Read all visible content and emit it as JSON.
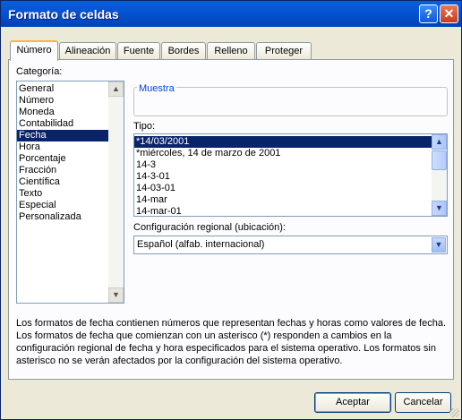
{
  "window": {
    "title": "Formato de celdas",
    "help_label": "?",
    "close_label": "✕"
  },
  "tabs": [
    {
      "label": "Número"
    },
    {
      "label": "Alineación"
    },
    {
      "label": "Fuente"
    },
    {
      "label": "Bordes"
    },
    {
      "label": "Relleno"
    },
    {
      "label": "Proteger"
    }
  ],
  "categoria": {
    "label": "Categoría:",
    "items": [
      "General",
      "Número",
      "Moneda",
      "Contabilidad",
      "Fecha",
      "Hora",
      "Porcentaje",
      "Fracción",
      "Científica",
      "Texto",
      "Especial",
      "Personalizada"
    ],
    "selected": "Fecha"
  },
  "muestra": {
    "label": "Muestra",
    "value": ""
  },
  "tipo": {
    "label": "Tipo:",
    "items": [
      "*14/03/2001",
      "*miércoles, 14 de marzo de 2001",
      "14-3",
      "14-3-01",
      "14-03-01",
      "14-mar",
      "14-mar-01"
    ],
    "selected": "*14/03/2001"
  },
  "regional": {
    "label": "Configuración regional (ubicación):",
    "value": "Español (alfab. internacional)"
  },
  "description": "Los formatos de fecha contienen números que representan fechas y horas como valores de fecha. Los formatos de fecha que comienzan con un asterisco (*) responden a cambios en la configuración regional de fecha y hora especificados para el sistema operativo. Los formatos sin asterisco no se verán afectados por la configuración del sistema operativo.",
  "buttons": {
    "accept": "Aceptar",
    "cancel": "Cancelar"
  },
  "icons": {
    "scroll_up": "▲",
    "scroll_down": "▼",
    "dropdown": "▼"
  }
}
